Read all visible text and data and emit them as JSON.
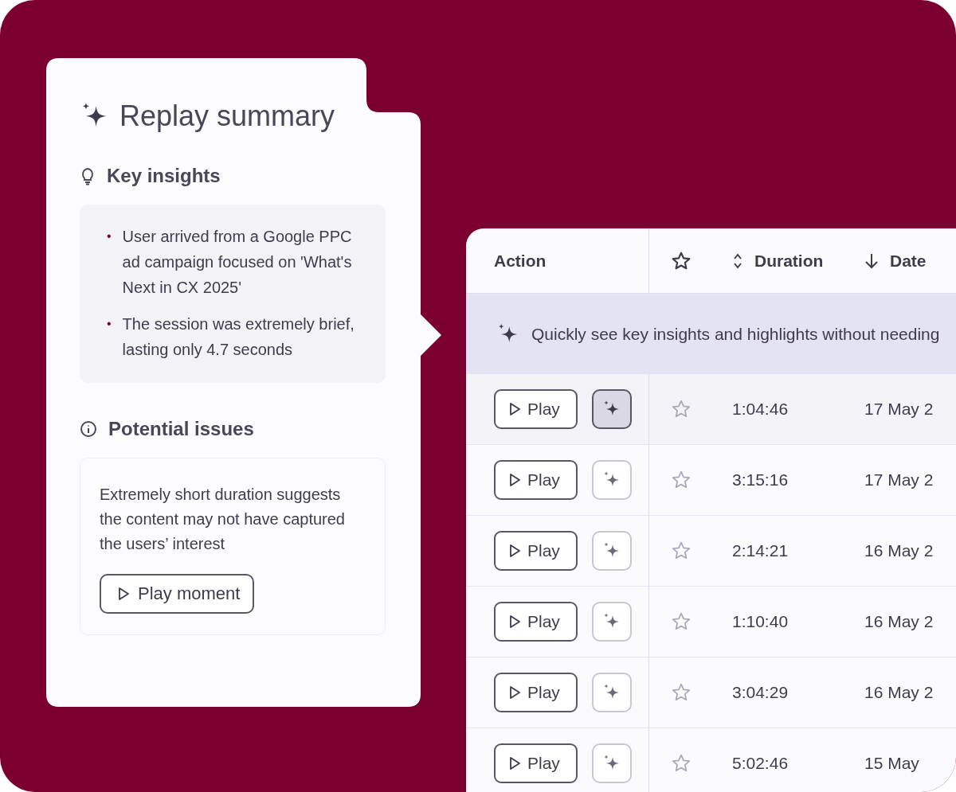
{
  "summary": {
    "title": "Replay summary",
    "insights": {
      "heading": "Key insights",
      "bullet": "•",
      "items": [
        "User arrived from a Google PPC ad campaign focused on 'What's Next in CX 2025'",
        "The session was extremely brief, lasting only 4.7 seconds"
      ]
    },
    "issues": {
      "heading": "Potential issues",
      "text": "Extremely short duration suggests the content may not have captured the users’ interest",
      "button": "Play moment"
    }
  },
  "table": {
    "columns": [
      {
        "label": "Action",
        "kind": "text"
      },
      {
        "kind": "star"
      },
      {
        "label": "Duration",
        "kind": "sortable"
      },
      {
        "label": "Date",
        "kind": "sorted-desc"
      }
    ],
    "banner": "Quickly see key insights and highlights without needing",
    "rows": [
      {
        "play": "Play",
        "starred": false,
        "selected": true,
        "duration": "1:04:46",
        "date": "17 May 2"
      },
      {
        "play": "Play",
        "starred": false,
        "selected": false,
        "duration": "3:15:16",
        "date": "17 May 2"
      },
      {
        "play": "Play",
        "starred": false,
        "selected": false,
        "duration": "2:14:21",
        "date": "16 May 2"
      },
      {
        "play": "Play",
        "starred": false,
        "selected": false,
        "duration": "1:10:40",
        "date": "16 May 2"
      },
      {
        "play": "Play",
        "starred": false,
        "selected": false,
        "duration": "3:04:29",
        "date": "16 May 2"
      },
      {
        "play": "Play",
        "starred": false,
        "selected": false,
        "duration": "5:02:46",
        "date": "15 May"
      }
    ]
  }
}
